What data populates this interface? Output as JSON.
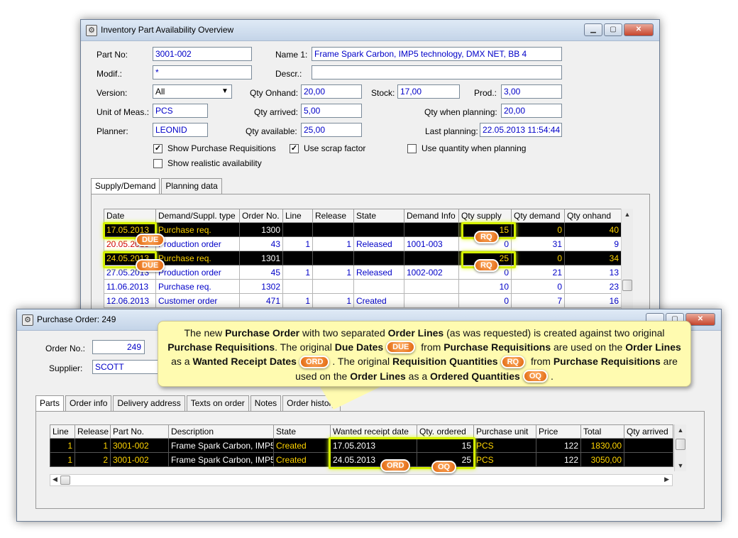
{
  "inv_window": {
    "title": "Inventory Part Availability Overview",
    "labels": {
      "part_no": "Part No:",
      "modif": "Modif.:",
      "version": "Version:",
      "uom": "Unit of Meas.:",
      "planner": "Planner:",
      "name1": "Name 1:",
      "descr": "Descr.:",
      "qty_onhand": "Qty Onhand:",
      "stock": "Stock:",
      "prod": "Prod.:",
      "qty_arrived": "Qty arrived:",
      "qty_when_planning": "Qty when planning:",
      "qty_available": "Qty available:",
      "last_planning": "Last planning:"
    },
    "values": {
      "part_no": "3001-002",
      "modif": "*",
      "version": "All",
      "uom": "PCS",
      "planner": "LEONID",
      "name1": "Frame Spark Carbon, IMP5 technology, DMX NET, BB 4",
      "descr": "",
      "qty_onhand": "20,00",
      "stock": "17,00",
      "prod": "3,00",
      "qty_arrived": "5,00",
      "qty_when_planning": "20,00",
      "qty_available": "25,00",
      "last_planning": "22.05.2013 11:54:44"
    },
    "checkboxes": {
      "show_pr": "Show Purchase Requisitions",
      "use_scrap": "Use scrap factor",
      "use_qty_planning": "Use quantity when planning",
      "show_realistic": "Show realistic availability"
    },
    "tabs": [
      "Supply/Demand",
      "Planning data"
    ],
    "columns": [
      "Date",
      "Demand/Suppl. type",
      "Order No.",
      "Line",
      "Release",
      "State",
      "Demand Info",
      "Qty supply",
      "Qty demand",
      "Qty onhand"
    ],
    "rows": [
      {
        "date": "17.05.2013",
        "type": "Purchase req.",
        "order": "1300",
        "line": "",
        "release": "",
        "state": "",
        "info": "",
        "supply": "15",
        "demand": "0",
        "onhand": "40"
      },
      {
        "date": "20.05.2013",
        "type": "Production order",
        "order": "43",
        "line": "1",
        "release": "1",
        "state": "Released",
        "info": "1001-003",
        "supply": "0",
        "demand": "31",
        "onhand": "9"
      },
      {
        "date": "24.05.2013",
        "type": "Purchase req.",
        "order": "1301",
        "line": "",
        "release": "",
        "state": "",
        "info": "",
        "supply": "25",
        "demand": "0",
        "onhand": "34"
      },
      {
        "date": "27.05.2013",
        "type": "Production order",
        "order": "45",
        "line": "1",
        "release": "1",
        "state": "Released",
        "info": "1002-002",
        "supply": "0",
        "demand": "21",
        "onhand": "13"
      },
      {
        "date": "11.06.2013",
        "type": "Purchase req.",
        "order": "1302",
        "line": "",
        "release": "",
        "state": "",
        "info": "",
        "supply": "10",
        "demand": "0",
        "onhand": "23"
      },
      {
        "date": "12.06.2013",
        "type": "Customer order",
        "order": "471",
        "line": "1",
        "release": "1",
        "state": "Created",
        "info": "",
        "supply": "0",
        "demand": "7",
        "onhand": "16"
      }
    ]
  },
  "po_window": {
    "title": "Purchase Order: 249",
    "labels": {
      "order_no": "Order No.:",
      "supplier": "Supplier:"
    },
    "values": {
      "order_no": "249",
      "supplier": "SCOTT"
    },
    "tabs": [
      "Parts",
      "Order info",
      "Delivery address",
      "Texts on order",
      "Notes",
      "Order history"
    ],
    "columns": [
      "Line",
      "Release",
      "Part No.",
      "Description",
      "State",
      "Wanted receipt date",
      "Qty. ordered",
      "Purchase unit",
      "Price",
      "Total",
      "Qty arrived"
    ],
    "rows": [
      {
        "line": "1",
        "release": "1",
        "part": "3001-002",
        "desc": "Frame Spark Carbon, IMP5",
        "state": "Created",
        "wanted": "17.05.2013",
        "qty": "15",
        "unit": "PCS",
        "price": "122",
        "total": "1830,00",
        "arrived": ""
      },
      {
        "line": "1",
        "release": "2",
        "part": "3001-002",
        "desc": "Frame Spark Carbon, IMP5",
        "state": "Created",
        "wanted": "24.05.2013",
        "qty": "25",
        "unit": "PCS",
        "price": "122",
        "total": "3050,00",
        "arrived": ""
      }
    ]
  },
  "badges": {
    "due": "DUE",
    "rq": "RQ",
    "ord": "ORD",
    "oq": "OQ"
  },
  "callout": {
    "t1": "The new ",
    "b1": "Purchase Order",
    "t2": " with two separated ",
    "b2": "Order Lines",
    "t3": " (as was requested) is created against two original ",
    "b3": "Purchase Requisitions",
    "t4": ". The original ",
    "b4": "Due Dates",
    "t5": " from ",
    "b5": "Purchase Requisitions",
    "t6": " are used on the ",
    "b6": "Order Lines",
    "t7": " as a ",
    "b7": "Wanted Receipt Dates",
    "t8": ". The original ",
    "b8": "Requisition Quantities",
    "t9": " from ",
    "b9": "Purchase Requisitions",
    "t10": " are used on the ",
    "b10": "Order Lines",
    "t11": " as a ",
    "b11": "Ordered Quantities",
    "t12": "."
  },
  "colors": {
    "accent_highlight": "#d4f000",
    "badge": "#e0640a",
    "selected_row_text": "#ffd400",
    "field_text": "#0000c8"
  }
}
